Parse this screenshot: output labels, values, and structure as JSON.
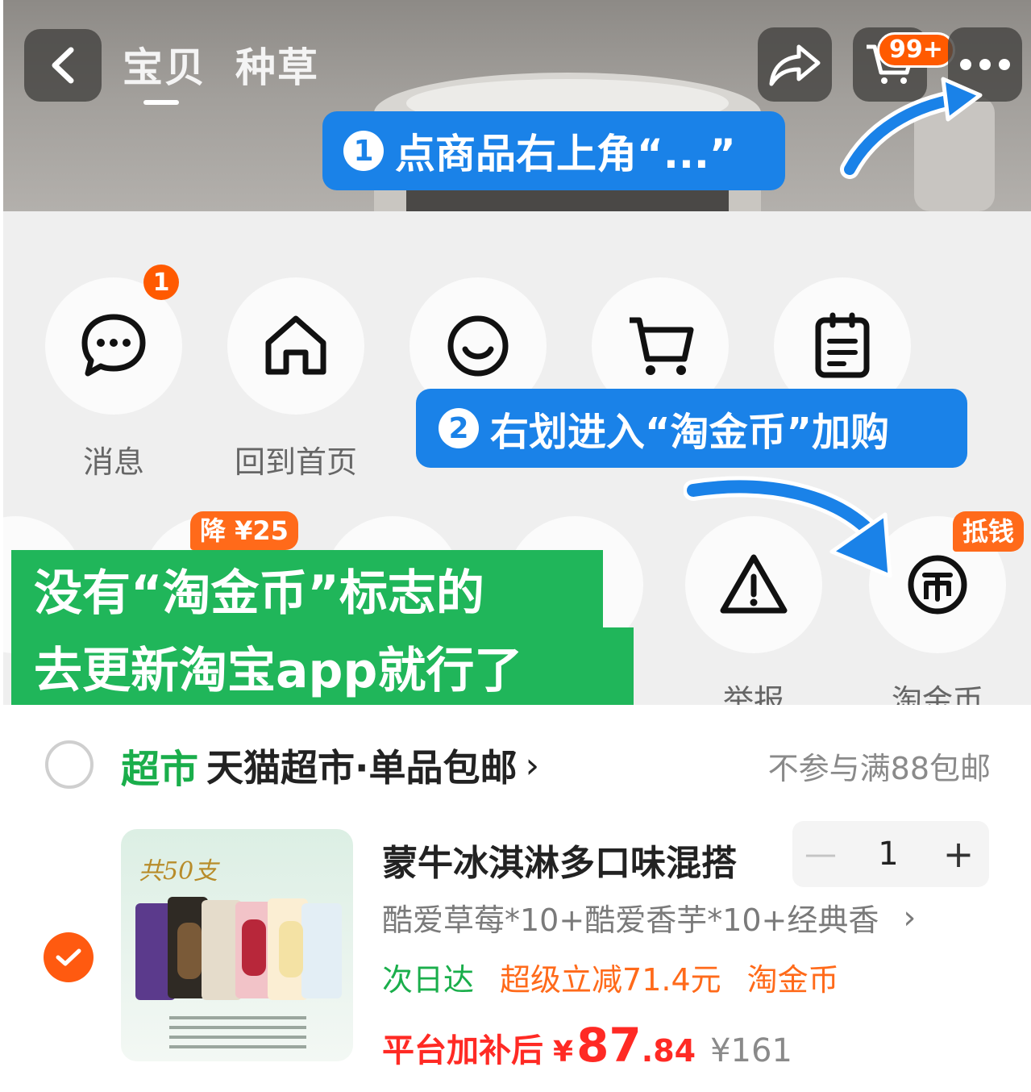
{
  "header": {
    "tabs": [
      {
        "label": "宝贝",
        "active": true
      },
      {
        "label": "种草",
        "active": false
      }
    ],
    "cart_badge": "99+"
  },
  "callouts": {
    "step1": {
      "number": "1",
      "text": "点商品右上角“...”"
    },
    "step2": {
      "number": "2",
      "text": "右划进入“淘金币”加购"
    },
    "green_line1": "没有“淘金币”标志的",
    "green_line2": "去更新淘宝app就行了"
  },
  "menu": {
    "row1": [
      {
        "label": "消息",
        "icon": "chat-bubble-icon",
        "badge": "1"
      },
      {
        "label": "回到首页",
        "icon": "home-icon"
      },
      {
        "label": "",
        "icon": "smile-icon"
      },
      {
        "label": "",
        "icon": "cart-icon"
      },
      {
        "label": "",
        "icon": "clipboard-icon"
      }
    ],
    "row2": [
      {
        "label": "举报",
        "icon": "warning-icon"
      },
      {
        "label": "淘金币",
        "icon": "coin-icon",
        "tag": "抵钱"
      }
    ],
    "discount_tag": "降 ¥25"
  },
  "cart": {
    "store_tag": "超市",
    "store_name": "天猫超市·单品包邮",
    "store_note": "不参与满88包邮",
    "item": {
      "title": "蒙牛冰淇淋多口味混搭",
      "quantity": "1",
      "sku": "酷爱草莓*10+酷爱香芋*10+经典香",
      "tags": {
        "delivery": "次日达",
        "discount": "超级立减71.4元",
        "coin": "淘金币"
      },
      "price_label": "平台加补后",
      "currency": "¥",
      "price_int": "87",
      "price_dec": ".84",
      "price_orig": "¥161",
      "thumb_badge": "共50支"
    }
  },
  "colors": {
    "accent": "#ff5a00",
    "callout_blue": "#1a82e8",
    "callout_green": "#20b65a",
    "price_red": "#ff2a24",
    "tmall_green": "#1aae4b"
  }
}
